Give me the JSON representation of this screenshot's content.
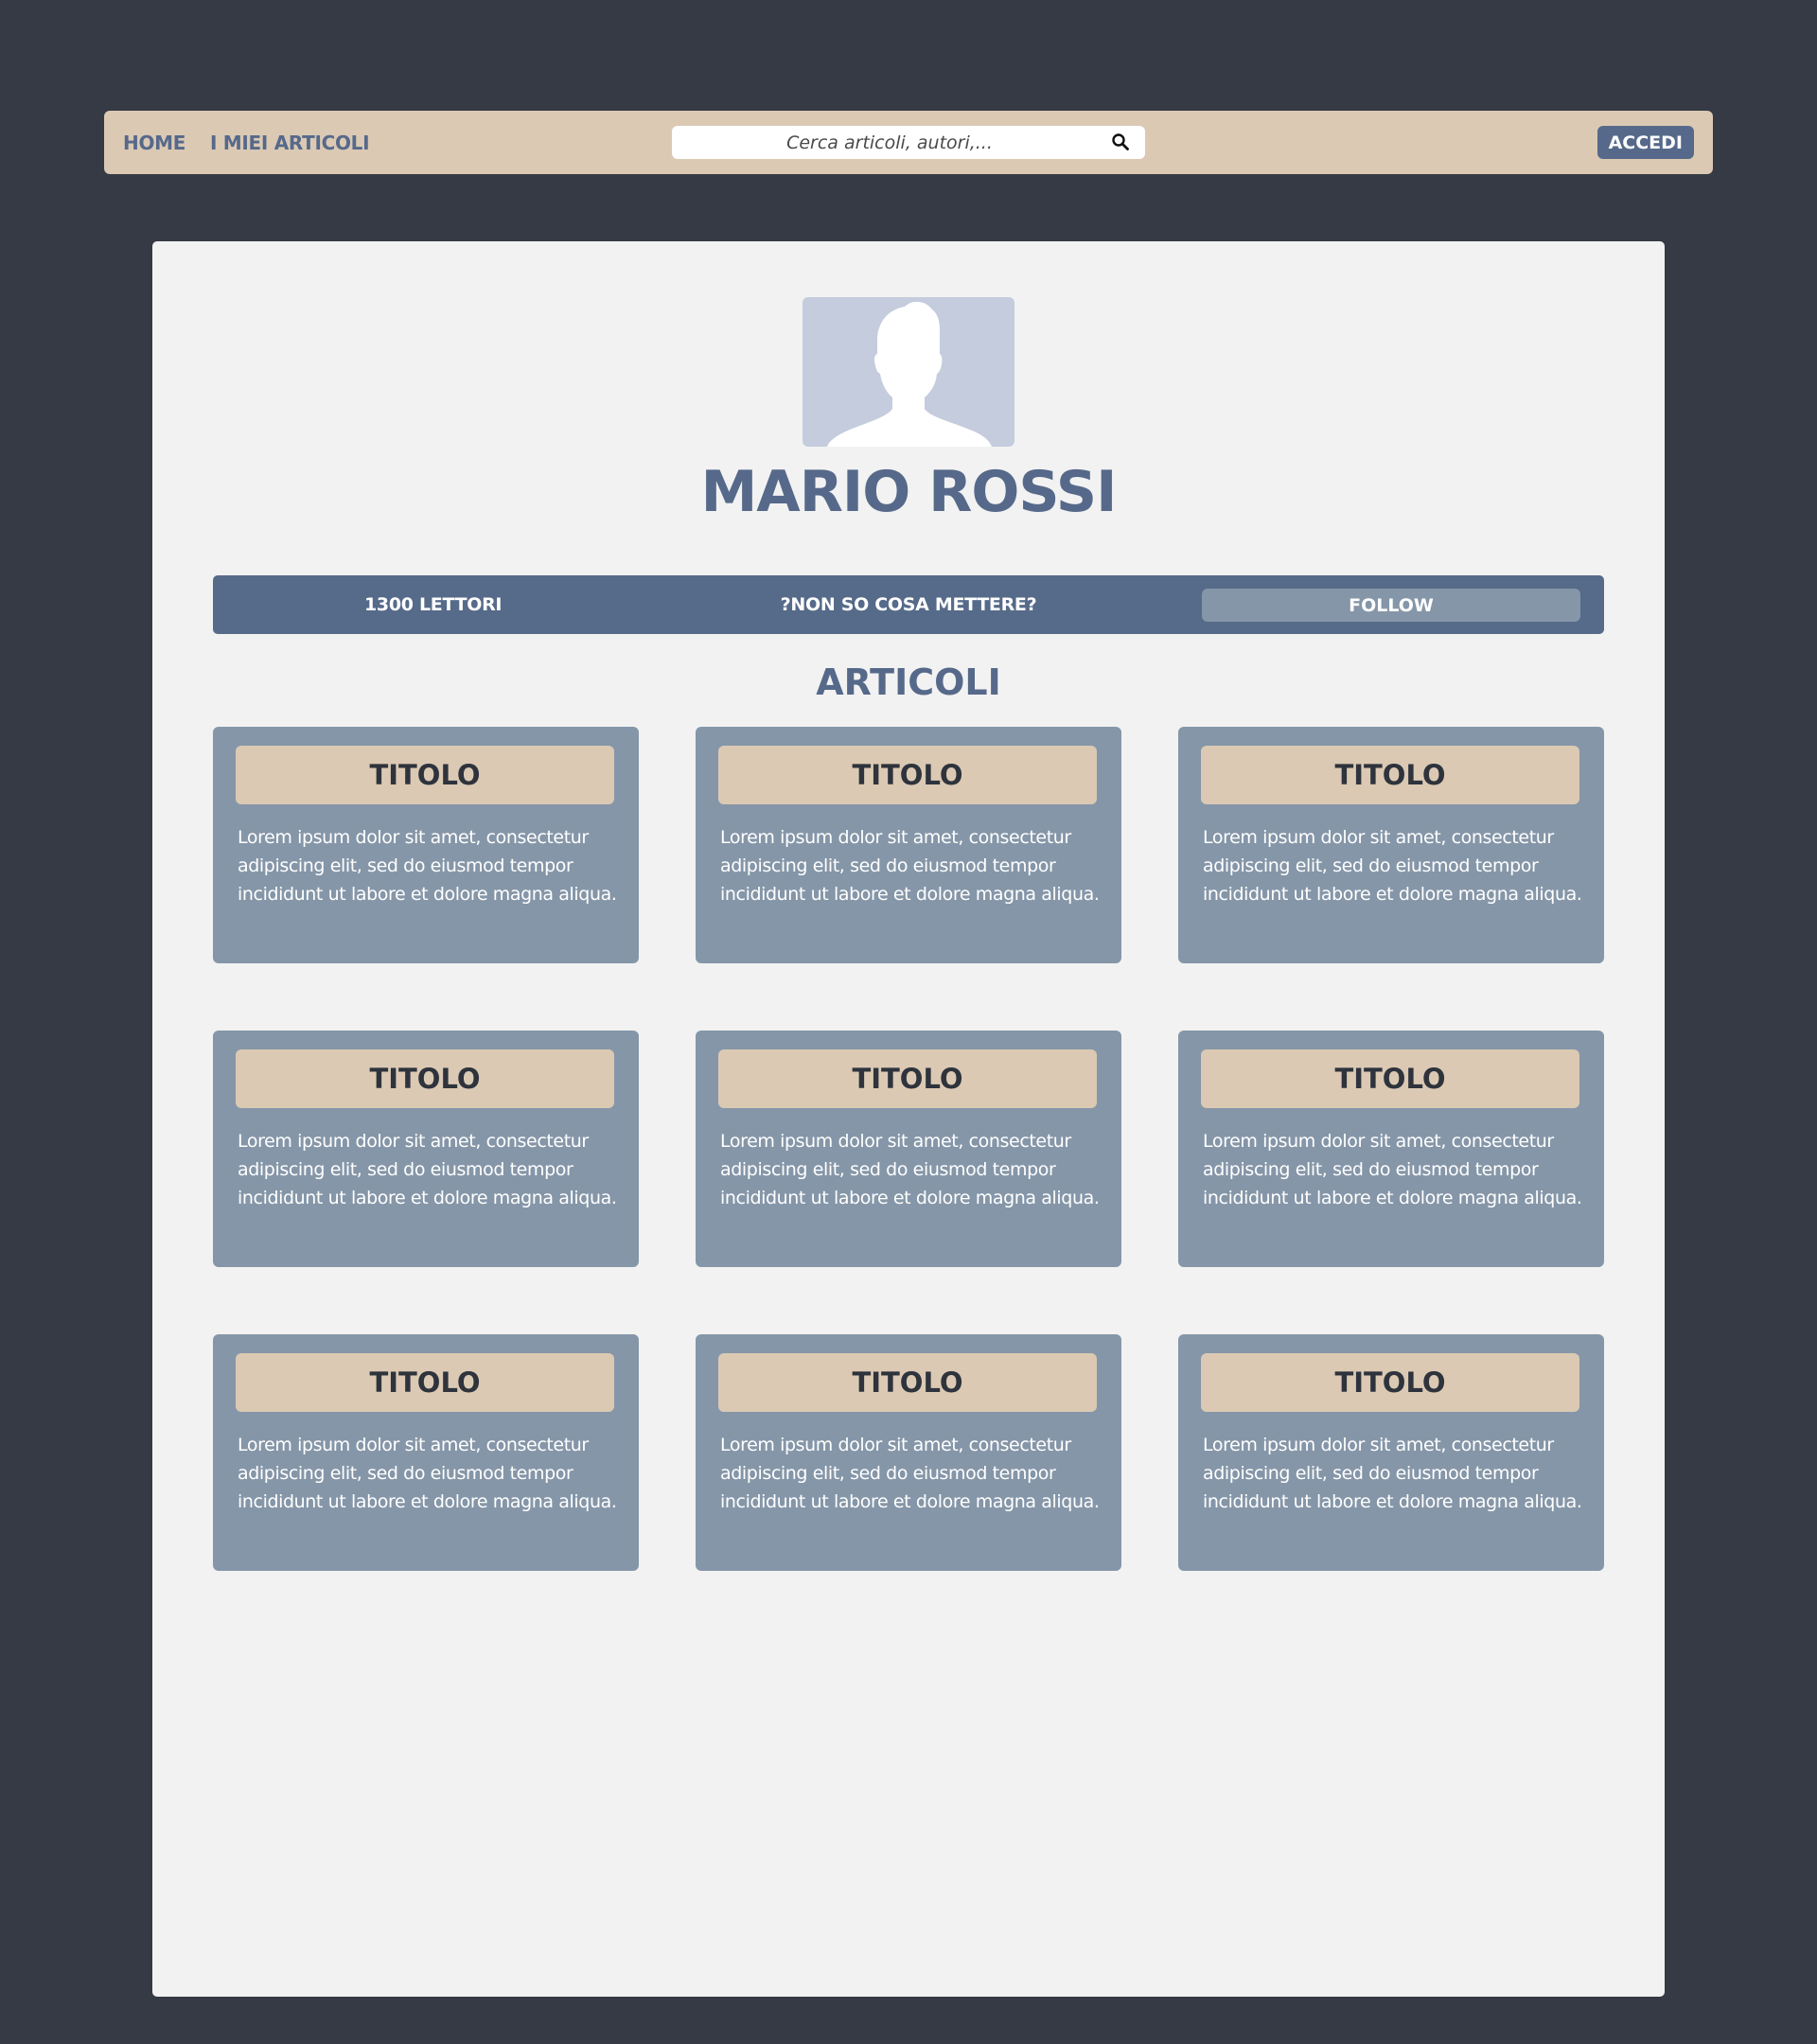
{
  "navbar": {
    "home_label": "HOME",
    "my_articles_label": "I MIEI ARTICOLI",
    "search_placeholder": "Cerca articoli, autori,...",
    "search_icon": "search-icon",
    "login_label": "ACCEDI"
  },
  "profile": {
    "avatar_icon": "user-silhouette-icon",
    "name": "MARIO ROSSI"
  },
  "stats": {
    "readers": "1300 LETTORI",
    "other": "?NON SO COSA METTERE?",
    "follow_label": "FOLLOW"
  },
  "articles_section": {
    "title": "ARTICOLI",
    "items": [
      {
        "title": "TITOLO",
        "body": "Lorem ipsum dolor sit amet, consectetur adipiscing elit, sed do eiusmod tempor incididunt ut labore et dolore magna aliqua."
      },
      {
        "title": "TITOLO",
        "body": "Lorem ipsum dolor sit amet, consectetur adipiscing elit, sed do eiusmod tempor incididunt ut labore et dolore magna aliqua."
      },
      {
        "title": "TITOLO",
        "body": "Lorem ipsum dolor sit amet, consectetur adipiscing elit, sed do eiusmod tempor incididunt ut labore et dolore magna aliqua."
      },
      {
        "title": "TITOLO",
        "body": "Lorem ipsum dolor sit amet, consectetur adipiscing elit, sed do eiusmod tempor incididunt ut labore et dolore magna aliqua."
      },
      {
        "title": "TITOLO",
        "body": "Lorem ipsum dolor sit amet, consectetur adipiscing elit, sed do eiusmod tempor incididunt ut labore et dolore magna aliqua."
      },
      {
        "title": "TITOLO",
        "body": "Lorem ipsum dolor sit amet, consectetur adipiscing elit, sed do eiusmod tempor incididunt ut labore et dolore magna aliqua."
      },
      {
        "title": "TITOLO",
        "body": "Lorem ipsum dolor sit amet, consectetur adipiscing elit, sed do eiusmod tempor incididunt ut labore et dolore magna aliqua."
      },
      {
        "title": "TITOLO",
        "body": "Lorem ipsum dolor sit amet, consectetur adipiscing elit, sed do eiusmod tempor incididunt ut labore et dolore magna aliqua."
      },
      {
        "title": "TITOLO",
        "body": "Lorem ipsum dolor sit amet, consectetur adipiscing elit, sed do eiusmod tempor incididunt ut labore et dolore magna aliqua."
      }
    ]
  },
  "colors": {
    "page_background": "#353a44",
    "navbar_background": "#dbc9b4",
    "accent_blue": "#56698a",
    "card_background": "#8596a8",
    "panel_background": "#f2f2f2",
    "avatar_background": "#c4ccdd"
  }
}
